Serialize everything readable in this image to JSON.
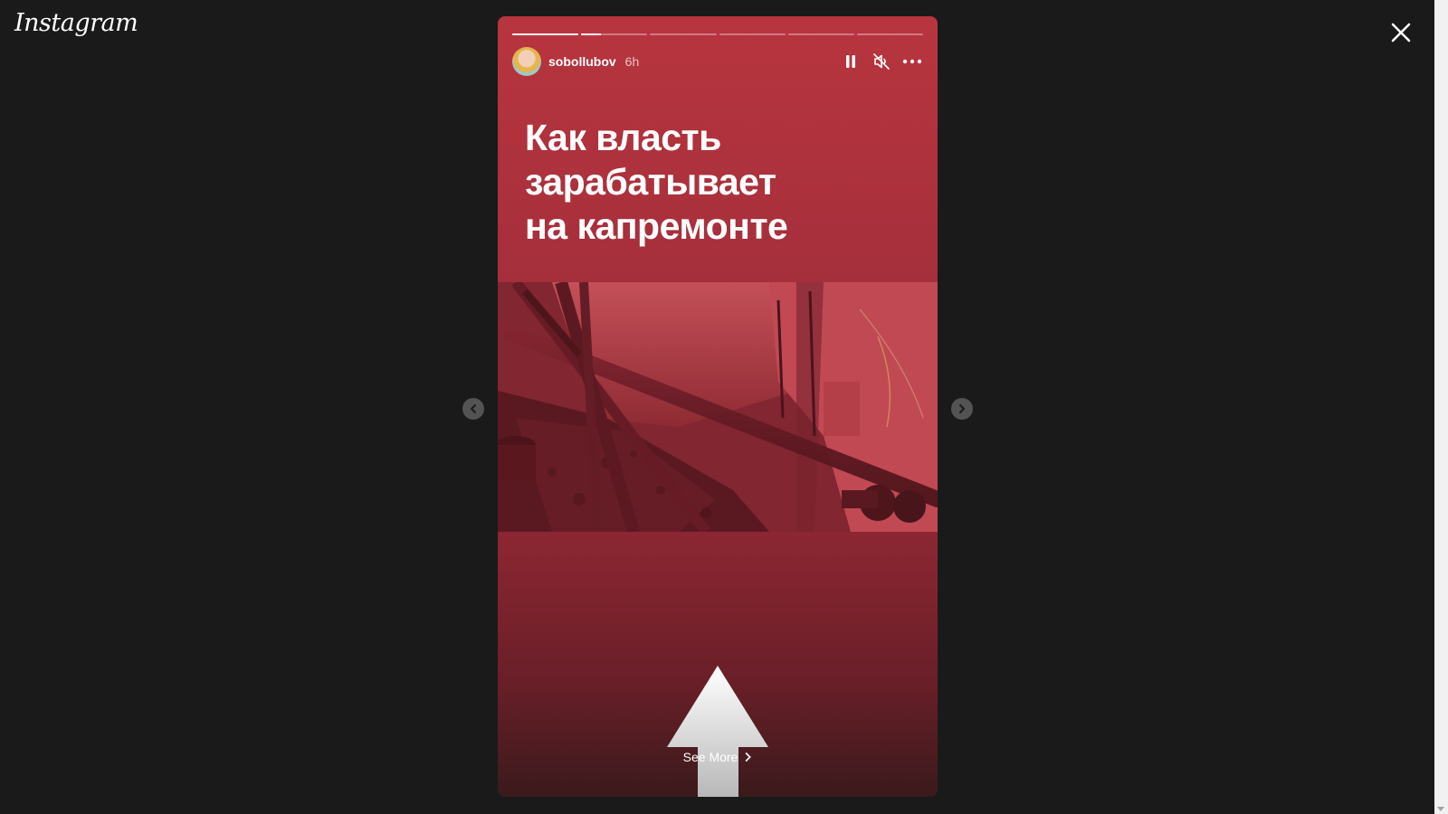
{
  "app": {
    "logo_text": "Instagram"
  },
  "story": {
    "progress": [
      1.0,
      0.3,
      0,
      0,
      0,
      0
    ],
    "user": {
      "username": "sobollubov",
      "time": "6h"
    },
    "headline": [
      "Как власть",
      "зарабатывает",
      "на капремонте"
    ],
    "see_more": "See More",
    "icons": {
      "close": "close-icon",
      "pause": "pause-icon",
      "mute": "muted-speaker-icon",
      "more": "more-options-icon",
      "prev": "chevron-left-icon",
      "next": "chevron-right-icon",
      "swipe": "swipe-up-arrow-icon"
    },
    "colors": {
      "background": "#1a1a1a",
      "accent": "#b8353f"
    }
  }
}
